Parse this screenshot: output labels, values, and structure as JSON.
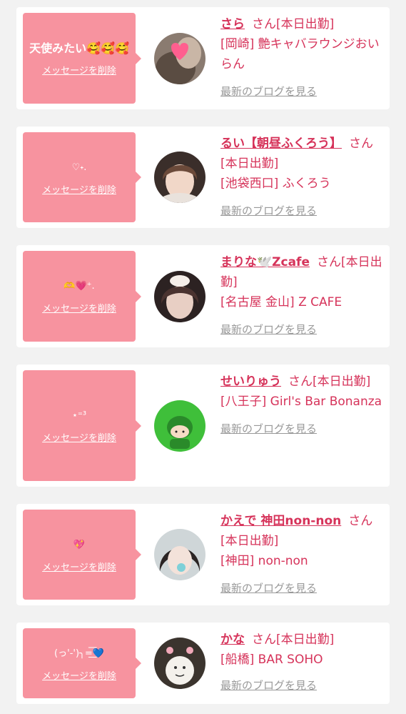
{
  "delete_label": "メッセージを削除",
  "blog_label": "最新のブログを見る",
  "san": "さん",
  "colors": {
    "accent": "#d6335a",
    "bubble": "#f7939f",
    "muted": "#999999"
  },
  "items": [
    {
      "message": "天使みたい🥰🥰🥰",
      "name": "さら",
      "status": "[本日出勤]",
      "area": "[岡崎]",
      "shop": "艶キャバラウンジおいらん"
    },
    {
      "message": "♡˖.",
      "name": "るい【朝昼ふくろう】",
      "status": "[本日出勤]",
      "area": "[池袋西口]",
      "shop": "ふくろう"
    },
    {
      "message": "🫶💗⁺.",
      "name": "まりな🕊️Zcafe",
      "status": "[本日出勤]",
      "area": "[名古屋 金山]",
      "shop": "Z CAFE"
    },
    {
      "message": "⋆⁼³",
      "name": "せいりゅう",
      "status": "[本日出勤]",
      "area": "[八王子]",
      "shop": "Girl's Bar Bonanza"
    },
    {
      "message": "💖",
      "name": "かえで 神田non-non",
      "status": "[本日出勤]",
      "area": "[神田]",
      "shop": "non-non"
    },
    {
      "message": "(っ'-')╮=͟͟͞͞💙",
      "name": "かな",
      "status": "[本日出勤]",
      "area": "[船橋]",
      "shop": "BAR SOHO"
    }
  ]
}
